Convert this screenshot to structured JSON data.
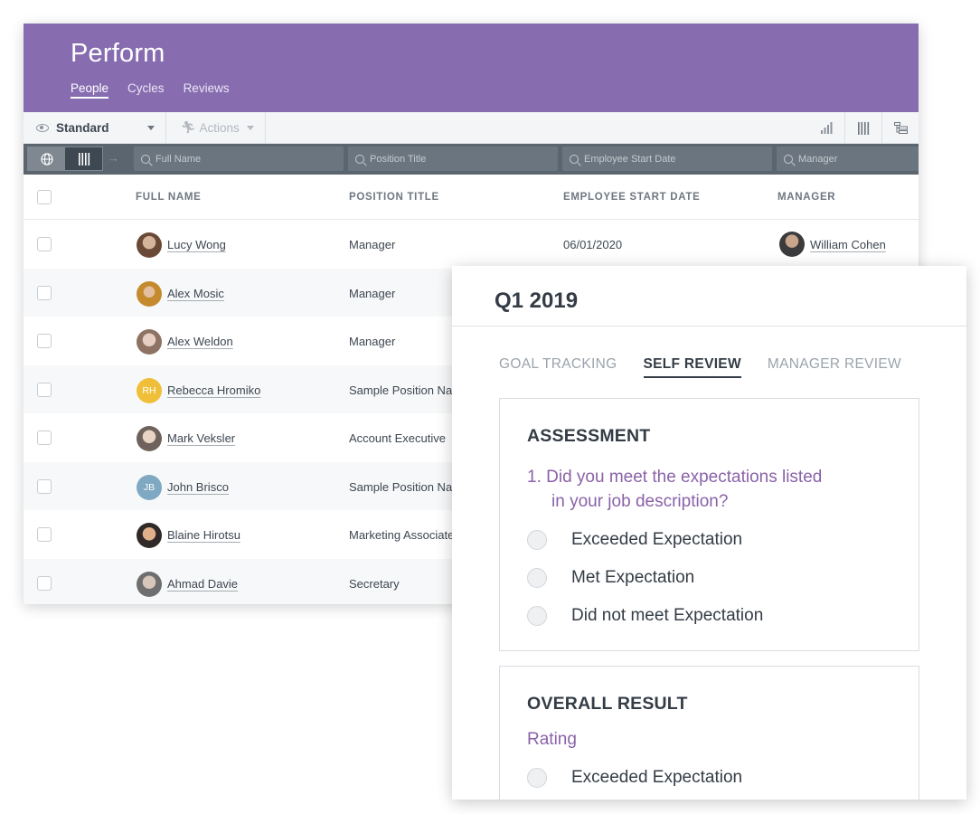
{
  "app": {
    "title": "Perform",
    "nav": [
      "People",
      "Cycles",
      "Reviews"
    ],
    "active_nav": "People"
  },
  "toolbar": {
    "view_label": "Standard",
    "actions_label": "Actions"
  },
  "filters": {
    "full_name_placeholder": "Full Name",
    "position_placeholder": "Position Title",
    "start_date_placeholder": "Employee Start Date",
    "manager_placeholder": "Manager"
  },
  "table": {
    "columns": [
      "FULL NAME",
      "POSITION TITLE",
      "EMPLOYEE START DATE",
      "MANAGER"
    ],
    "rows": [
      {
        "name": "Lucy Wong",
        "position": "Manager",
        "start_date": "06/01/2020",
        "manager": "William Cohen",
        "avatar": "photo",
        "avatar_color": "#7a5a44"
      },
      {
        "name": "Alex Mosic",
        "position": "Manager",
        "start_date": "",
        "manager": "",
        "avatar": "photo",
        "avatar_color": "#b9853e"
      },
      {
        "name": "Alex Weldon",
        "position": "Manager",
        "start_date": "",
        "manager": "",
        "avatar": "photo",
        "avatar_color": "#9b8276"
      },
      {
        "name": "Rebecca Hromiko",
        "position": "Sample Position Nar",
        "start_date": "",
        "manager": "",
        "avatar": "RH",
        "avatar_color": "#f0bf3a"
      },
      {
        "name": "Mark Veksler",
        "position": "Account Executive",
        "start_date": "",
        "manager": "",
        "avatar": "photo",
        "avatar_color": "#8d7f77"
      },
      {
        "name": "John Brisco",
        "position": "Sample Position Nar",
        "start_date": "",
        "manager": "",
        "avatar": "JB",
        "avatar_color": "#7fa8c2"
      },
      {
        "name": "Blaine Hirotsu",
        "position": "Marketing Associate",
        "start_date": "",
        "manager": "",
        "avatar": "photo",
        "avatar_color": "#a47858"
      },
      {
        "name": "Ahmad Davie",
        "position": "Secretary",
        "start_date": "",
        "manager": "",
        "avatar": "photo",
        "avatar_color": "#8a8a8a"
      }
    ]
  },
  "review": {
    "title": "Q1 2019",
    "tabs": [
      "GOAL TRACKING",
      "SELF REVIEW",
      "MANAGER REVIEW"
    ],
    "active_tab": "SELF REVIEW",
    "assessment": {
      "heading": "ASSESSMENT",
      "question_line1": "1. Did you meet the expectations listed",
      "question_line2": "in your job description?",
      "options": [
        "Exceeded Expectation",
        "Met Expectation",
        "Did not meet Expectation"
      ]
    },
    "overall": {
      "heading": "OVERALL RESULT",
      "sub": "Rating",
      "options": [
        "Exceeded Expectation"
      ]
    }
  },
  "colors": {
    "brand": "#876db0",
    "question_accent": "#8a62a8",
    "filter_bar": "#5a6570"
  }
}
